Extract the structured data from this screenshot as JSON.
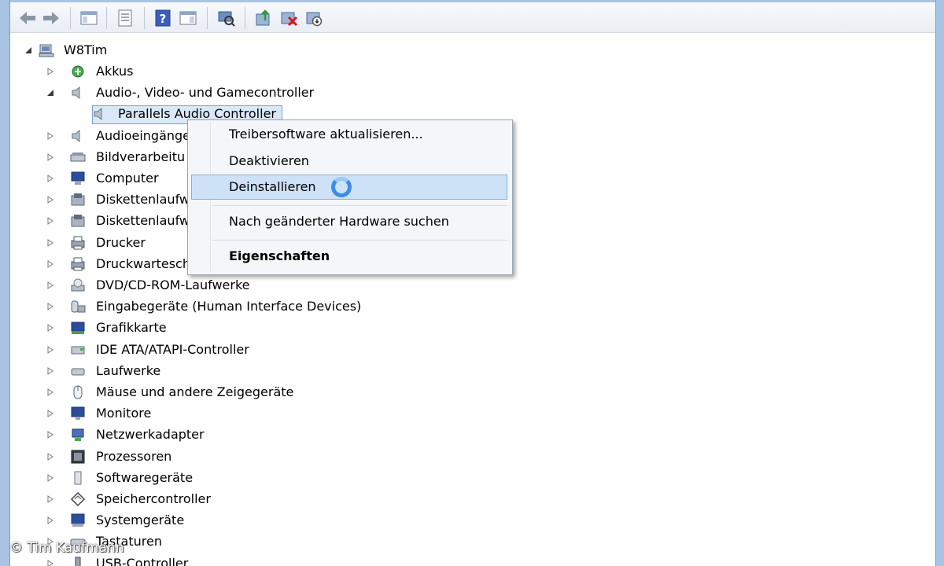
{
  "toolbar": {
    "buttons": [
      {
        "name": "back-arrow-icon"
      },
      {
        "name": "forward-arrow-icon"
      },
      {
        "name": "show-hide-console-tree-icon"
      },
      {
        "name": "properties-icon"
      },
      {
        "name": "help-icon"
      },
      {
        "name": "action-pane-icon"
      },
      {
        "name": "scan-hardware-icon"
      },
      {
        "name": "update-driver-icon"
      },
      {
        "name": "uninstall-device-icon"
      },
      {
        "name": "disable-device-icon"
      }
    ]
  },
  "tree": {
    "root": "W8Tim",
    "items": [
      {
        "label": "Akkus",
        "icon": "battery-icon",
        "expanded": false
      },
      {
        "label": "Audio-, Video- und Gamecontroller",
        "icon": "speaker-icon",
        "expanded": true
      },
      {
        "label": "Parallels Audio Controller",
        "icon": "speaker-icon",
        "child": true
      },
      {
        "label": "Audioeingänge",
        "icon": "speaker-icon",
        "expanded": false
      },
      {
        "label": "Bildverarbeitu",
        "icon": "scanner-icon",
        "expanded": false
      },
      {
        "label": "Computer",
        "icon": "computer-icon",
        "expanded": false
      },
      {
        "label": "Diskettenlaufw",
        "icon": "floppy-icon",
        "expanded": false
      },
      {
        "label": "Diskettenlaufw",
        "icon": "floppy-icon",
        "expanded": false
      },
      {
        "label": "Drucker",
        "icon": "printer-icon",
        "expanded": false
      },
      {
        "label": "Druckwartesch",
        "icon": "printer-icon",
        "expanded": false
      },
      {
        "label": "DVD/CD-ROM-Laufwerke",
        "icon": "dvd-drive-icon",
        "expanded": false
      },
      {
        "label": "Eingabegeräte (Human Interface Devices)",
        "icon": "hid-icon",
        "expanded": false
      },
      {
        "label": "Grafikkarte",
        "icon": "display-adapter-icon",
        "expanded": false
      },
      {
        "label": "IDE ATA/ATAPI-Controller",
        "icon": "ide-controller-icon",
        "expanded": false
      },
      {
        "label": "Laufwerke",
        "icon": "disk-drive-icon",
        "expanded": false
      },
      {
        "label": "Mäuse und andere Zeigegeräte",
        "icon": "mouse-icon",
        "expanded": false
      },
      {
        "label": "Monitore",
        "icon": "monitor-icon",
        "expanded": false
      },
      {
        "label": "Netzwerkadapter",
        "icon": "network-adapter-icon",
        "expanded": false
      },
      {
        "label": "Prozessoren",
        "icon": "processor-icon",
        "expanded": false
      },
      {
        "label": "Softwaregeräte",
        "icon": "software-device-icon",
        "expanded": false
      },
      {
        "label": "Speichercontroller",
        "icon": "storage-controller-icon",
        "expanded": false
      },
      {
        "label": "Systemgeräte",
        "icon": "system-device-icon",
        "expanded": false
      },
      {
        "label": "Tastaturen",
        "icon": "keyboard-icon",
        "expanded": false
      },
      {
        "label": "USB-Controller",
        "icon": "usb-icon",
        "expanded": false
      }
    ]
  },
  "context_menu": {
    "items": [
      {
        "label": "Treibersoftware aktualisieren..."
      },
      {
        "label": "Deaktivieren"
      },
      {
        "label": "Deinstallieren",
        "highlighted": true
      },
      {
        "label": "Nach geänderter Hardware suchen"
      },
      {
        "label": "Eigenschaften",
        "bold": true
      }
    ]
  },
  "watermark": "© Tim Kaufmann",
  "colors": {
    "window_frame": "#a9c3e2",
    "selection": "#dbe8f7",
    "menu_highlight": "#cde1f7",
    "busy_spinner": "#3d8ce6"
  }
}
